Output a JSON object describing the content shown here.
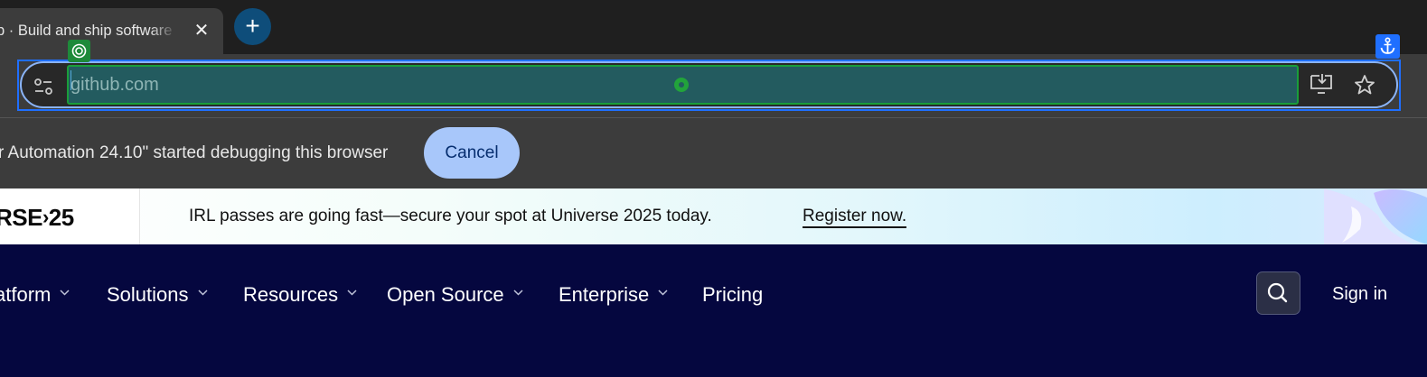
{
  "browser": {
    "tab_title": "p · Build and ship software",
    "tab_close": "✕",
    "new_tab": "+",
    "url": "github.com",
    "infobar_message": "r Automation 24.10\" started debugging this browser",
    "cancel_label": "Cancel"
  },
  "banner": {
    "logo": "RSE⁠›25",
    "message": "IRL passes are going fast—secure your spot at Universe 2025 today.",
    "link": "Register now."
  },
  "nav": {
    "items": [
      {
        "label": "atform",
        "dropdown": true
      },
      {
        "label": "Solutions",
        "dropdown": true
      },
      {
        "label": "Resources",
        "dropdown": true
      },
      {
        "label": "Open Source",
        "dropdown": true
      },
      {
        "label": "Enterprise",
        "dropdown": true
      },
      {
        "label": "Pricing",
        "dropdown": false
      }
    ],
    "signin": "Sign in"
  },
  "colors": {
    "nav_bg": "#05073f",
    "cancel_bg": "#a8c7fa",
    "url_highlight": "#235b5f",
    "outline_blue": "#1f6fff"
  }
}
